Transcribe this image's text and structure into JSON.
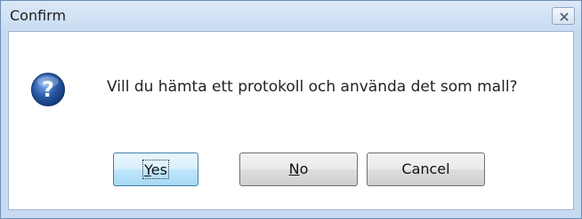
{
  "window": {
    "title": "Confirm",
    "close_icon": "close-icon"
  },
  "dialog": {
    "icon": "question-icon",
    "message": "Vill du hämta ett protokoll och använda det som mall?"
  },
  "buttons": {
    "yes": {
      "mnemonic": "Y",
      "rest": "es"
    },
    "no": {
      "mnemonic": "N",
      "rest": "o"
    },
    "cancel": {
      "label": "Cancel"
    }
  },
  "colors": {
    "frame": "#c7daf0",
    "default_button": "#bee6fd",
    "question_icon": "#2a5aa8"
  }
}
